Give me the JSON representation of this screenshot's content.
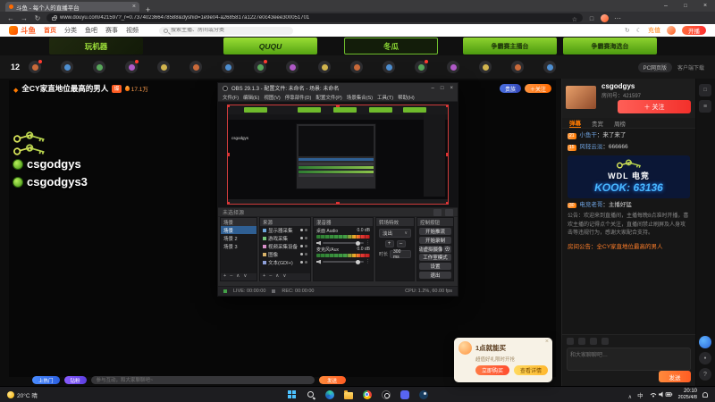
{
  "browser": {
    "tab_title": "斗鱼 - 每个人的直播平台",
    "url": "www.douyu.com/421597?_r=0.737402366478588&dyshid=1e9e04-a2685817a1227e0c43eee300051701"
  },
  "header": {
    "brand": "斗鱼",
    "nav": [
      "首页",
      "分类",
      "鱼吧",
      "赛事",
      "视频"
    ],
    "search_placeholder": "搜索主播、房间或分类",
    "recharge": "充值",
    "broadcast": "开播"
  },
  "banner": {
    "tiles": [
      "玩机器",
      "QUQU",
      "冬瓜",
      "争霸赛主播台",
      "争霸赛海选台"
    ]
  },
  "category_bar": {
    "count": "12",
    "pc_badge": "PC网页版",
    "client_link": "客户端下载"
  },
  "player": {
    "title": "全CY家直地位最高的男人",
    "badge": "爆",
    "heat": "17.1万",
    "noble_pill": "贵族",
    "follow_pill": "＋关注",
    "overlay_name_1": "csgodgys",
    "overlay_name_2": "csgodgys3",
    "danmu": {
      "pill1": "上热门",
      "pill2": "钻粉",
      "placeholder": "参与互动，和大家聊聊吧~",
      "send": "发送"
    }
  },
  "obs": {
    "title": "OBS 29.1.3 - 配置文件: 未命名 - 场景: 未命名",
    "menu": [
      "文件(F)",
      "编辑(E)",
      "视图(V)",
      "停靠部件(D)",
      "配置文件(P)",
      "场景集合(S)",
      "工具(T)",
      "帮助(H)"
    ],
    "source_toolbar": "未选择源",
    "scenes_title": "场景",
    "scenes": [
      "场景",
      "场景 2",
      "场景 3"
    ],
    "sources_title": "来源",
    "sources": [
      "显示器采集",
      "游戏采集",
      "视频采集设备",
      "图像",
      "文本(GDI+)"
    ],
    "mixer_title": "混音器",
    "mixer": [
      {
        "name": "桌面 Audio",
        "db": "0.0 dB"
      },
      {
        "name": "麦克风/Aux",
        "db": "0.0 dB"
      }
    ],
    "transitions_title": "转场特效",
    "transition": "淡出",
    "duration_label": "时长",
    "duration": "300 ms",
    "controls_title": "控制按钮",
    "controls": [
      "开始推流",
      "开始录制",
      "启动虚拟摄像机",
      "工作室模式",
      "设置",
      "退出"
    ],
    "status_live": "LIVE: 00:00:00",
    "status_rec": "REC: 00:00:00",
    "status_cpu": "CPU: 1.2%, 60.00 fps"
  },
  "sidebar": {
    "streamer_name": "csgodgys",
    "room_no": "房间号：421597",
    "follow_button": "＋ 关注",
    "tabs": [
      "弹幕",
      "贵宾",
      "周榜"
    ],
    "chat": [
      {
        "level": "21",
        "user": "小鱼干",
        "text": "来了来了"
      },
      {
        "level": "15",
        "user": "风轻云淡",
        "text": "666666"
      },
      {
        "level": "30",
        "user": "电竞老哥",
        "text": "主播好猛"
      }
    ],
    "promo": {
      "brand": "WDL 电竞",
      "code": "KOOK: 63136"
    },
    "notice": "公告：欢迎来到直播间，主播每晚8点准时开播，喜欢主播的记得点个关注，直播间禁止刷屏及人身攻击等违规行为，感谢大家配合支持。",
    "highlight": "房间公告：全CY家直地位最高的男人",
    "input_placeholder": "和大家聊聊吧…",
    "send": "发送"
  },
  "gift_popup": {
    "title": "1点就能买",
    "desc": "超值好礼限时开抢",
    "primary": "立即购买",
    "secondary": "查看详情"
  },
  "taskbar": {
    "weather": "20°C 晴",
    "lang": "中",
    "time": "20:10",
    "date": "2025/4/8"
  }
}
